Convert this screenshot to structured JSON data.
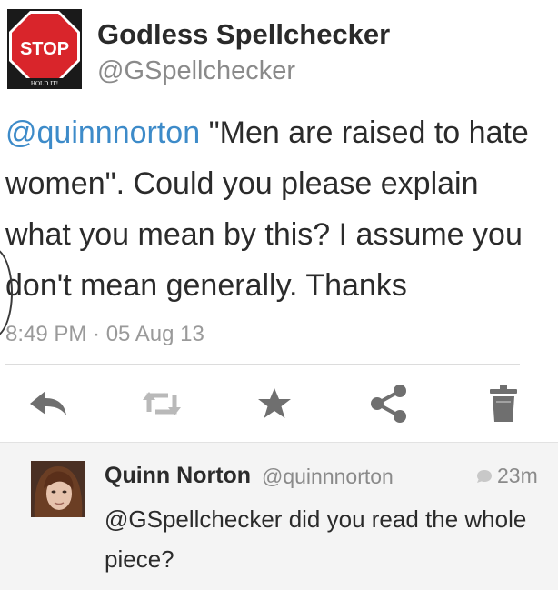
{
  "tweet": {
    "avatar_sign_text": "STOP",
    "avatar_caption": "HOLD IT!",
    "display_name": "Godless Spellchecker",
    "handle": "@GSpellchecker",
    "mention": "@quinnnorton",
    "body": " \"Men are raised to hate women\". Could you please explain what you mean by this? I assume you don't mean generally. Thanks",
    "timestamp": "8:49 PM · 05 Aug 13"
  },
  "actions": [
    {
      "name": "reply",
      "icon": "reply-arrow-icon"
    },
    {
      "name": "retweet",
      "icon": "retweet-icon"
    },
    {
      "name": "favorite",
      "icon": "star-icon"
    },
    {
      "name": "share",
      "icon": "share-icon"
    },
    {
      "name": "delete",
      "icon": "trash-icon"
    }
  ],
  "reply": {
    "display_name": "Quinn Norton",
    "handle": "@quinnnorton",
    "time": "23m",
    "text": "@GSpellchecker did you read the whole piece?"
  },
  "colors": {
    "mention": "#3d8bc9",
    "icon": "#6f6f6f",
    "stop_red": "#d9252b",
    "reply_bg": "#f4f4f4"
  }
}
